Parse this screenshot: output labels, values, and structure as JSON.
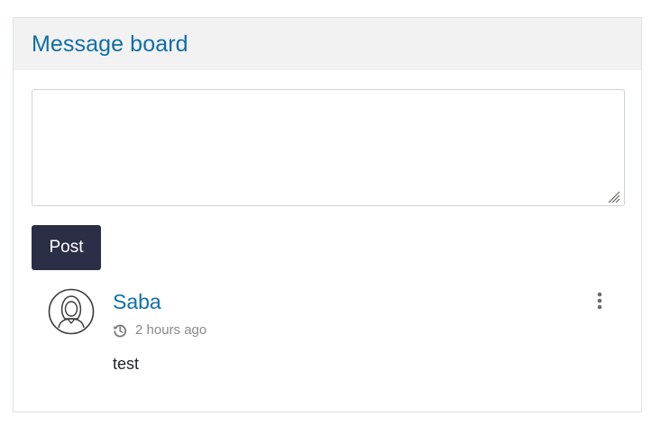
{
  "board": {
    "title": "Message board",
    "input_value": "",
    "post_label": "Post"
  },
  "messages": [
    {
      "author": "Saba",
      "time": "2 hours ago",
      "text": "test",
      "avatar_icon": "user-avatar-icon",
      "time_icon": "history-icon",
      "menu_icon": "more-vertical-icon"
    }
  ],
  "colors": {
    "accent": "#0f6fa8",
    "button_bg": "#2b2e47",
    "header_bg": "#f2f2f2",
    "muted_text": "#8a8a8a"
  }
}
